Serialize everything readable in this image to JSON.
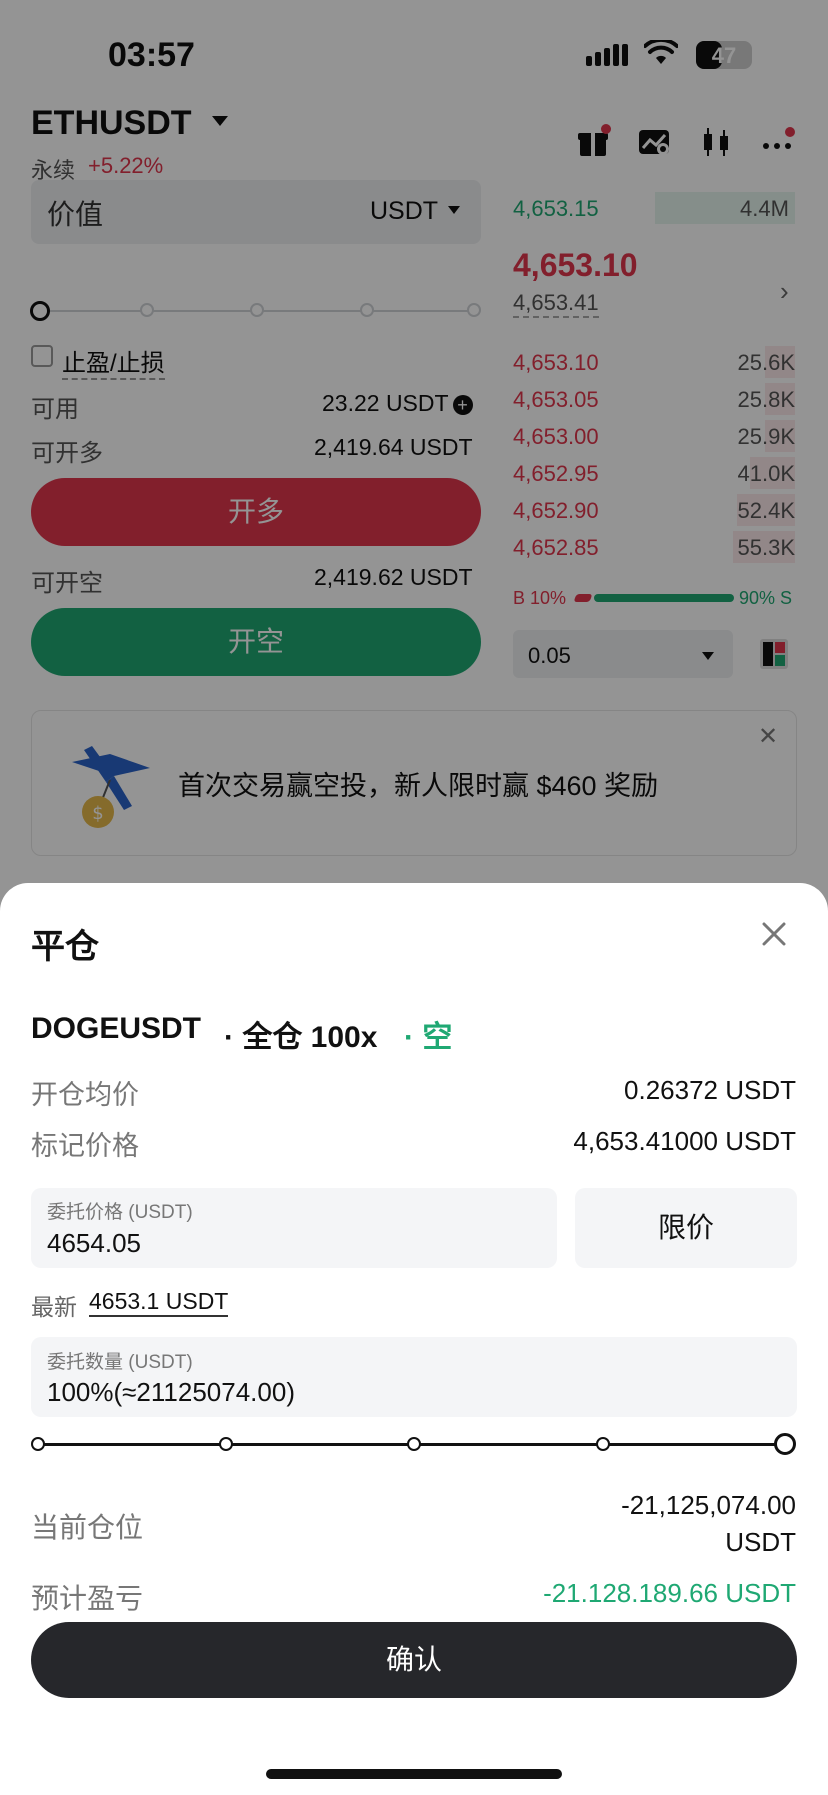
{
  "status_bar": {
    "time": "03:57",
    "battery": "47",
    "battery_level_percent": 47
  },
  "header": {
    "symbol": "ETHUSDT",
    "contract_type": "永续",
    "change": "+5.22%"
  },
  "order_form": {
    "value_label": "价值",
    "value_unit": "USDT",
    "tpsl_label": "止盈/止损",
    "available_label": "可用",
    "available_value": "23.22 USDT",
    "can_long_label": "可开多",
    "can_long_value": "2,419.64 USDT",
    "long_button": "开多",
    "can_short_label": "可开空",
    "can_short_value": "2,419.62 USDT",
    "short_button": "开空"
  },
  "order_book": {
    "top_price": "4,653.15",
    "top_qty": "4.4M",
    "last_price": "4,653.10",
    "mark_price": "4,653.41",
    "asks": [
      {
        "price": "4,653.10",
        "qty": "25.6K"
      },
      {
        "price": "4,653.05",
        "qty": "25.8K"
      },
      {
        "price": "4,653.00",
        "qty": "25.9K"
      },
      {
        "price": "4,652.95",
        "qty": "41.0K"
      },
      {
        "price": "4,652.90",
        "qty": "52.4K"
      },
      {
        "price": "4,652.85",
        "qty": "55.3K"
      }
    ],
    "buy_ratio": "B 10%",
    "sell_ratio": "90% S",
    "precision": "0.05"
  },
  "banner": {
    "text": "首次交易赢空投，新人限时赢 $460 奖励"
  },
  "sheet": {
    "title": "平仓",
    "symbol": "DOGEUSDT",
    "mode": "· 全仓 100x",
    "side": "· 空",
    "entry_label": "开仓均价",
    "entry_value": "0.26372 USDT",
    "mark_label": "标记价格",
    "mark_value": "4,653.41000 USDT",
    "price_field_label": "委托价格 (USDT)",
    "price_field_value": "4654.05",
    "order_type": "限价",
    "latest_label": "最新",
    "latest_value": "4653.1 USDT",
    "qty_field_label": "委托数量 (USDT)",
    "qty_field_value": "100%(≈21125074.00)",
    "qty_percent": 100,
    "position_label": "当前仓位",
    "position_value_line1": "-21,125,074.00",
    "position_value_line2": "USDT",
    "pnl_label": "预计盈亏",
    "pnl_value": "-21.128.189.66 USDT",
    "confirm_button": "确认"
  },
  "colors": {
    "red": "#e0364d",
    "green": "#1fa873",
    "dark": "#26272b"
  },
  "icons": [
    "gift-icon",
    "chart-settings-icon",
    "candlestick-icon",
    "more-icon",
    "close-icon",
    "caret-down-icon",
    "chevron-right-icon",
    "plus-circle-icon",
    "layout-icon"
  ]
}
